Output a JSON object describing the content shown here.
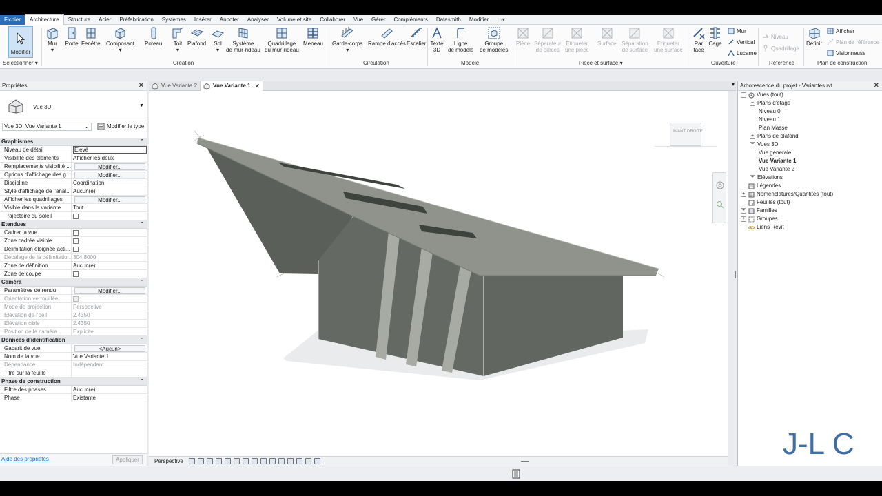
{
  "menu": {
    "tabs": [
      "Fichier",
      "Architecture",
      "Structure",
      "Acier",
      "Préfabrication",
      "Systèmes",
      "Insérer",
      "Annoter",
      "Analyser",
      "Volume et site",
      "Collaborer",
      "Vue",
      "Gérer",
      "Compléments",
      "Datasmith",
      "Modifier"
    ],
    "active": "Architecture"
  },
  "ribbon": {
    "modify": "Modifier",
    "select": "Sélectionner",
    "creation": {
      "group": "Création",
      "mur": "Mur",
      "porte": "Porte",
      "fenetre": "Fenêtre",
      "composant": "Composant",
      "poteau": "Poteau",
      "toit": "Toit",
      "plafond": "Plafond",
      "sol": "Sol",
      "systeme1": "Système",
      "systeme2": "de mur-rideau",
      "quad1": "Quadrillage",
      "quad2": "du mur-rideau",
      "meneau": "Meneau"
    },
    "circulation": {
      "group": "Circulation",
      "garde": "Garde-corps",
      "rampe": "Rampe d'accès",
      "escalier": "Escalier"
    },
    "modele": {
      "group": "Modèle",
      "texte1": "Texte",
      "texte2": "3D",
      "ligne1": "Ligne",
      "ligne2": "de modèle",
      "groupe1": "Groupe",
      "groupe2": "de modèles"
    },
    "piece": {
      "group": "Pièce et surface",
      "piece": "Pièce",
      "sep1": "Séparateur",
      "sep2": "de pièces",
      "etq1": "Etiqueter",
      "etq2": "une pièce",
      "surface": "Surface",
      "sepsurf1": "Séparation",
      "sepsurf2": "de surface",
      "etqs1": "Etiqueter",
      "etqs2": "une surface"
    },
    "ouverture": {
      "group": "Ouverture",
      "parface1": "Par",
      "parface2": "face",
      "cage": "Cage",
      "mur": "Mur",
      "vertical": "Vertical",
      "lucarne": "Lucarne"
    },
    "reference": {
      "group": "Référence",
      "niveau": "Niveau",
      "quadrillage": "Quadrillage"
    },
    "plan": {
      "group": "Plan de construction",
      "definir": "Définir",
      "afficher": "Afficher",
      "planref": "Plan de référence",
      "visionneuse": "Visionneuse"
    }
  },
  "properties": {
    "title": "Propriétés",
    "type_name": "Vue 3D",
    "instance": "Vue 3D: Vue Variante 1",
    "edit_type": "Modifier le type",
    "sections": [
      {
        "name": "Graphismes",
        "rows": [
          {
            "k": "Niveau de détail",
            "v": "Elevé",
            "style": "boxed"
          },
          {
            "k": "Visibilité des éléments",
            "v": "Afficher les deux"
          },
          {
            "k": "Remplacements visibilité ...",
            "v": "Modifier...",
            "style": "btn"
          },
          {
            "k": "Options d'affichage des g...",
            "v": "Modifier...",
            "style": "btn"
          },
          {
            "k": "Discipline",
            "v": "Coordination"
          },
          {
            "k": "Style d'affichage de l'anal...",
            "v": "Aucun(e)"
          },
          {
            "k": "Afficher les quadrillages",
            "v": "Modifier...",
            "style": "btn"
          },
          {
            "k": "Visible dans la variante",
            "v": "Tout"
          },
          {
            "k": "Trajectoire du soleil",
            "v": "",
            "style": "chk"
          }
        ]
      },
      {
        "name": "Etendues",
        "rows": [
          {
            "k": "Cadrer la vue",
            "v": "",
            "style": "chk"
          },
          {
            "k": "Zone cadrée visible",
            "v": "",
            "style": "chk"
          },
          {
            "k": "Délimitation éloignée acti...",
            "v": "",
            "style": "chk"
          },
          {
            "k": "Décalage de la délimitatio...",
            "v": "304.8000",
            "dis": true
          },
          {
            "k": "Zone de définition",
            "v": "Aucun(e)"
          },
          {
            "k": "Zone de coupe",
            "v": "",
            "style": "chk"
          }
        ]
      },
      {
        "name": "Caméra",
        "rows": [
          {
            "k": "Paramètres de rendu",
            "v": "Modifier...",
            "style": "btn"
          },
          {
            "k": "Orientation verrouillée",
            "v": "",
            "style": "chkdis",
            "dis": true
          },
          {
            "k": "Mode de projection",
            "v": "Perspective",
            "dis": true
          },
          {
            "k": "Elévation de l'oeil",
            "v": "2.4350",
            "dis": true
          },
          {
            "k": "Elévation cible",
            "v": "2.4350",
            "dis": true
          },
          {
            "k": "Position de la caméra",
            "v": "Explicite",
            "dis": true
          }
        ]
      },
      {
        "name": "Données d'identification",
        "rows": [
          {
            "k": "Gabarit de vue",
            "v": "<Aucun>",
            "style": "btn"
          },
          {
            "k": "Nom de la vue",
            "v": "Vue Variante 1"
          },
          {
            "k": "Dépendance",
            "v": "Indépendant",
            "dis": true
          },
          {
            "k": "Titre sur la feuille",
            "v": ""
          }
        ]
      },
      {
        "name": "Phase de construction",
        "rows": [
          {
            "k": "Filtre des phases",
            "v": "Aucun(e)"
          },
          {
            "k": "Phase",
            "v": "Existante"
          }
        ]
      }
    ],
    "help": "Aide des propriétés",
    "apply": "Appliquer"
  },
  "view_tabs": [
    {
      "label": "Vue Variante 2",
      "active": false
    },
    {
      "label": "Vue Variante 1",
      "active": true
    }
  ],
  "viewcube": {
    "front": "AVANT",
    "right": "DROITE"
  },
  "view_bar": {
    "projection": "Perspective"
  },
  "browser": {
    "title": "Arborescence du projet - Variantes.rvt",
    "items": [
      {
        "label": "Vues (tout)",
        "level": 0,
        "toggle": "-",
        "icon": "views"
      },
      {
        "label": "Plans d'étage",
        "level": 1,
        "toggle": "-"
      },
      {
        "label": "Niveau 0",
        "level": 2
      },
      {
        "label": "Niveau 1",
        "level": 2
      },
      {
        "label": "Plan Masse",
        "level": 2
      },
      {
        "label": "Plans de plafond",
        "level": 1,
        "toggle": "+"
      },
      {
        "label": "Vues 3D",
        "level": 1,
        "toggle": "-"
      },
      {
        "label": "Vue generale",
        "level": 2
      },
      {
        "label": "Vue Variante 1",
        "level": 2,
        "selected": true
      },
      {
        "label": "Vue Variante 2",
        "level": 2
      },
      {
        "label": "Elévations",
        "level": 1,
        "toggle": "+"
      },
      {
        "label": "Légendes",
        "level": 0,
        "icon": "legend"
      },
      {
        "label": "Nomenclatures/Quantités (tout)",
        "level": 0,
        "toggle": "+",
        "icon": "table"
      },
      {
        "label": "Feuilles (tout)",
        "level": 0,
        "icon": "sheet"
      },
      {
        "label": "Familles",
        "level": 0,
        "toggle": "+",
        "icon": "family"
      },
      {
        "label": "Groupes",
        "level": 0,
        "toggle": "+",
        "icon": "group"
      },
      {
        "label": "Liens Revit",
        "level": 0,
        "icon": "link"
      }
    ]
  },
  "watermark": "J-L C",
  "colors": {
    "accent": "#2a6ebb",
    "selection": "#cfe3f7",
    "wall": "#6b6f68",
    "roof": "#8d918a",
    "watermark": "#3f6ea6"
  }
}
